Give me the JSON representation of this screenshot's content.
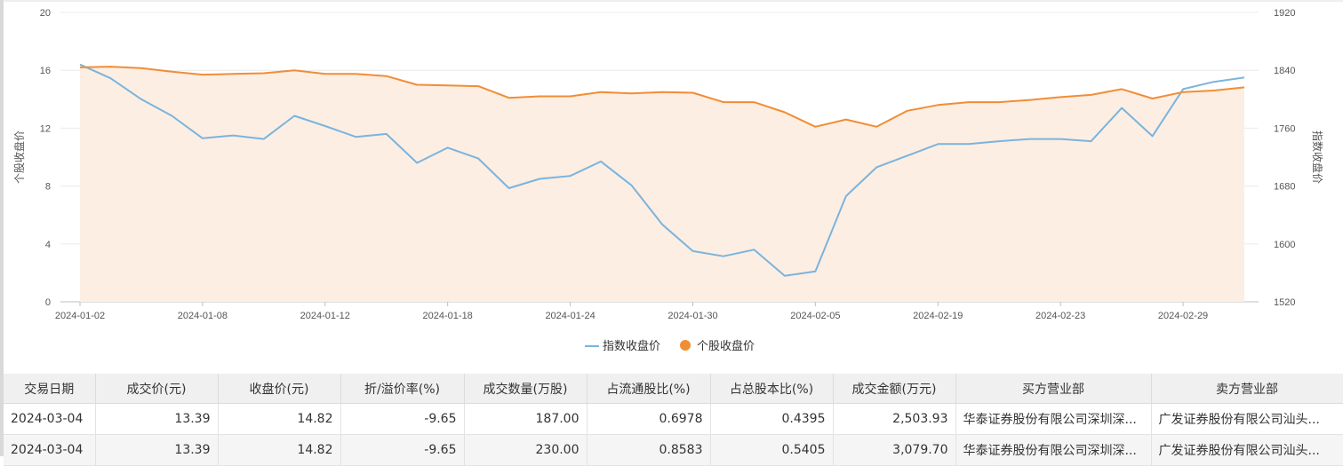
{
  "chart_data": {
    "type": "line",
    "x": [
      "2024-01-02",
      "2024-01-03",
      "2024-01-05",
      "2024-01-06",
      "2024-01-08",
      "2024-01-09",
      "2024-01-10",
      "2024-01-11",
      "2024-01-12",
      "2024-01-15",
      "2024-01-16",
      "2024-01-17",
      "2024-01-18",
      "2024-01-19",
      "2024-01-22",
      "2024-01-23",
      "2024-01-24",
      "2024-01-25",
      "2024-01-26",
      "2024-01-29",
      "2024-01-30",
      "2024-01-31",
      "2024-02-01",
      "2024-02-02",
      "2024-02-05",
      "2024-02-06",
      "2024-02-07",
      "2024-02-08",
      "2024-02-19",
      "2024-02-20",
      "2024-02-21",
      "2024-02-22",
      "2024-02-23",
      "2024-02-26",
      "2024-02-27",
      "2024-02-28",
      "2024-02-29",
      "2024-03-01",
      "2024-03-04"
    ],
    "x_ticks": [
      "2024-01-02",
      "2024-01-08",
      "2024-01-12",
      "2024-01-18",
      "2024-01-24",
      "2024-01-30",
      "2024-02-05",
      "2024-02-19",
      "2024-02-23",
      "2024-02-29"
    ],
    "series": [
      {
        "name": "指数收盘价",
        "axis": "right",
        "color": "#7ab4de",
        "values": [
          1848,
          1829,
          1800,
          1777,
          1746,
          1750,
          1745,
          1777,
          1763,
          1748,
          1752,
          1712,
          1733,
          1718,
          1677,
          1690,
          1694,
          1714,
          1681,
          1627,
          1590,
          1583,
          1592,
          1556,
          1562,
          1666,
          1706,
          1722,
          1738,
          1738,
          1742,
          1745,
          1745,
          1742,
          1788,
          1749,
          1814,
          1824,
          1830
        ]
      },
      {
        "name": "个股收盘价",
        "axis": "left",
        "color": "#f18d35",
        "values": [
          16.2,
          16.25,
          16.15,
          15.9,
          15.7,
          15.75,
          15.8,
          16.0,
          15.75,
          15.75,
          15.6,
          15.0,
          14.95,
          14.9,
          14.1,
          14.2,
          14.2,
          14.5,
          14.4,
          14.5,
          14.45,
          13.8,
          13.8,
          13.1,
          12.1,
          12.6,
          12.1,
          13.2,
          13.6,
          13.8,
          13.8,
          13.95,
          14.15,
          14.3,
          14.7,
          14.05,
          14.5,
          14.6,
          14.82
        ]
      }
    ],
    "y_left": {
      "label": "个股收盘价",
      "ticks": [
        "0",
        "4",
        "8",
        "12",
        "16",
        "20"
      ],
      "range": [
        0,
        20
      ]
    },
    "y_right": {
      "label": "指数收盘价",
      "ticks": [
        "1520",
        "1600",
        "1680",
        "1760",
        "1840",
        "1920"
      ],
      "range": [
        1520,
        1920
      ]
    },
    "legend": [
      "指数收盘价",
      "个股收盘价"
    ],
    "legend_position": "bottom-center",
    "grid": true
  },
  "table": {
    "headers": [
      "交易日期",
      "成交价(元)",
      "收盘价(元)",
      "折/溢价率(%)",
      "成交数量(万股)",
      "占流通股比(%)",
      "占总股本比(%)",
      "成交金额(万元)",
      "买方营业部",
      "卖方营业部"
    ],
    "rows": [
      [
        "2024-03-04",
        "13.39",
        "14.82",
        "-9.65",
        "187.00",
        "0.6978",
        "0.4395",
        "2,503.93",
        "华泰证券股份有限公司深圳深...",
        "广发证券股份有限公司汕头..."
      ],
      [
        "2024-03-04",
        "13.39",
        "14.82",
        "-9.65",
        "230.00",
        "0.8583",
        "0.5405",
        "3,079.70",
        "华泰证券股份有限公司深圳深...",
        "广发证券股份有限公司汕头..."
      ]
    ]
  },
  "colors": {
    "fill_area": "#fdeee3",
    "grid": "#ebebeb"
  }
}
